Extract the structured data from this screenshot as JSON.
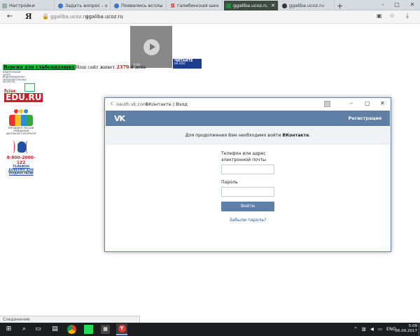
{
  "browser": {
    "tabs": [
      {
        "label": "Настройки",
        "icon": "gear-icon"
      },
      {
        "label": "Задать вопрос - uBoz",
        "icon": "ucoz-icon"
      },
      {
        "label": "Появились всплываю",
        "icon": "ucoz-icon"
      },
      {
        "label": "галибинская школа",
        "icon": "yandex-icon"
      },
      {
        "label": "ggaliba.ucoz.ru",
        "icon": "site-icon"
      },
      {
        "label": "ggaliba.ucoz.ru",
        "icon": "github-icon"
      }
    ],
    "new_tab": "+",
    "address": {
      "yandex_glyph": "Я",
      "domain_short": "ggaliba.ucoz.ru",
      "url": "ggaliba.ucoz.ru"
    },
    "status": "Соединение"
  },
  "page": {
    "vision_link": "Версия для слабовидящих",
    "site_age_prefix": "Наш сайт живет ",
    "site_age_days": "2379",
    "site_age_suffix": "-й день",
    "fcior": {
      "caption": "ФЕДЕРАЛЬНЫЙ ЦЕНТР ИНФОРМАЦИОННО-ОБРАЗОВАТЕЛЬНЫХ РЕСУРСОВ",
      "name": "fcior.",
      "edu": "EDU.RU"
    },
    "children_caption": "ПРЕЗИДЕНТ РОССИИ ГРАЖДАНАМ ШКОЛЬНОГО ВОЗРАСТА",
    "helpline": {
      "number": "8-800-2000-122",
      "caption": "ТЕЛЕФОН ДОВЕРИЯ ДЛЯ ПОДРОСТКОВ"
    },
    "video_time": "0:00",
    "ad_text_1": "ЧИТАЙТЕ",
    "ad_text_2": "НА EDU"
  },
  "popup": {
    "domain": "oauth.vk.com",
    "title": "ВКонтакте | Вход",
    "logo": "VK",
    "register": "Регистрация",
    "notice_prefix": "Для продолжения Вам необходимо войти ",
    "notice_brand": "ВКонтакте",
    "notice_suffix": ".",
    "phone_label": "Телефон или адрес электронной почты",
    "password_label": "Пароль",
    "login_button": "Войти",
    "forgot": "Забыли пароль?"
  },
  "taskbar": {
    "lang": "ENG",
    "time": "5:09",
    "date": "26.09.2017"
  }
}
